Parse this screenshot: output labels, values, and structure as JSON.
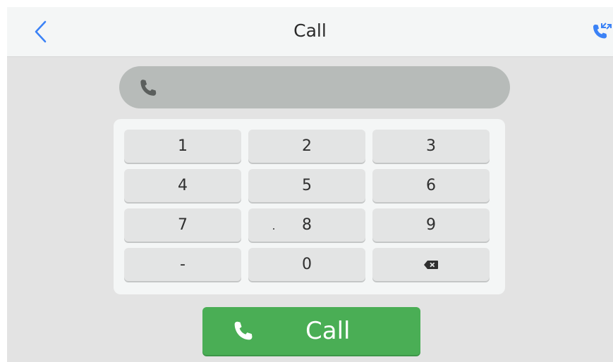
{
  "header": {
    "title": "Call",
    "back_icon": "chevron-left-icon",
    "history_icon": "call-history-icon",
    "accent_color": "#3b82f6"
  },
  "number_field": {
    "icon": "phone-icon",
    "value": ""
  },
  "keypad": {
    "keys": [
      {
        "label": "1",
        "name": "key-1"
      },
      {
        "label": "2",
        "name": "key-2"
      },
      {
        "label": "3",
        "name": "key-3"
      },
      {
        "label": "4",
        "name": "key-4"
      },
      {
        "label": "5",
        "name": "key-5"
      },
      {
        "label": "6",
        "name": "key-6"
      },
      {
        "label": "7",
        "name": "key-7"
      },
      {
        "label": "8",
        "name": "key-8"
      },
      {
        "label": "9",
        "name": "key-9"
      },
      {
        "label": "-",
        "name": "key-dash"
      },
      {
        "label": "0",
        "name": "key-0"
      },
      {
        "label": "",
        "name": "key-backspace",
        "icon": "backspace-icon"
      }
    ]
  },
  "call_button": {
    "label": "Call",
    "icon": "phone-icon",
    "color": "#4aae55"
  }
}
